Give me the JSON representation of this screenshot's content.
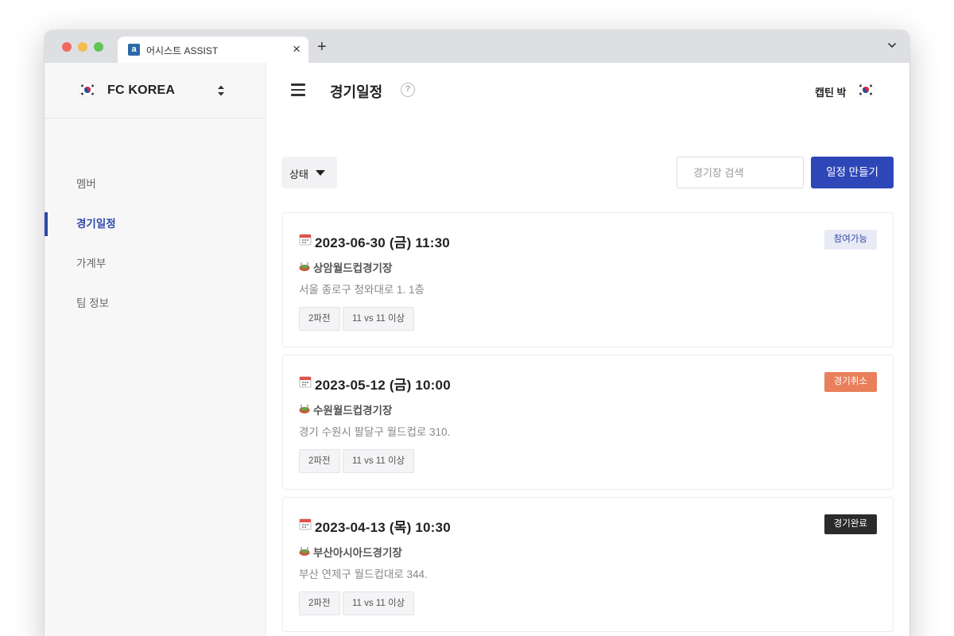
{
  "browser": {
    "tab_title": "어시스트 ASSIST",
    "favicon_letter": "a",
    "close_glyph": "×",
    "new_tab_glyph": "+"
  },
  "sidebar": {
    "team_name": "FC KOREA",
    "team_flag": "korea-flag-icon",
    "items": [
      {
        "label": "멤버",
        "active": false
      },
      {
        "label": "경기일정",
        "active": true
      },
      {
        "label": "가계부",
        "active": false
      },
      {
        "label": "팀 정보",
        "active": false
      }
    ]
  },
  "header": {
    "title": "경기일정",
    "help_glyph": "?",
    "user_name": "캡틴 박"
  },
  "toolbar": {
    "status_filter_label": "상태",
    "search_placeholder": "경기장 검색",
    "create_label": "일정 만들기"
  },
  "colors": {
    "accent": "#2e47b8",
    "status_available_bg": "#e8ebf6",
    "status_available_fg": "#2e47a8",
    "status_cancelled_bg": "#e9805b",
    "status_done_bg": "#2b2b2b"
  },
  "matches": [
    {
      "date": "2023-06-30 (금) 11:30",
      "status": "참여가능",
      "stadium": "상암월드컵경기장",
      "address": "서울 종로구 청와대로 1. 1층",
      "tags": [
        "2파전",
        "11 vs 11 이상"
      ]
    },
    {
      "date": "2023-05-12 (금) 10:00",
      "status": "경기취소",
      "stadium": "수원월드컵경기장",
      "address": "경기 수원시 팔달구 월드컵로 310.",
      "tags": [
        "2파전",
        "11 vs 11 이상"
      ]
    },
    {
      "date": "2023-04-13 (목) 10:30",
      "status": "경기완료",
      "stadium": "부산아시아드경기장",
      "address": "부산 연제구 월드컵대로 344.",
      "tags": [
        "2파전",
        "11 vs 11 이상"
      ]
    }
  ]
}
